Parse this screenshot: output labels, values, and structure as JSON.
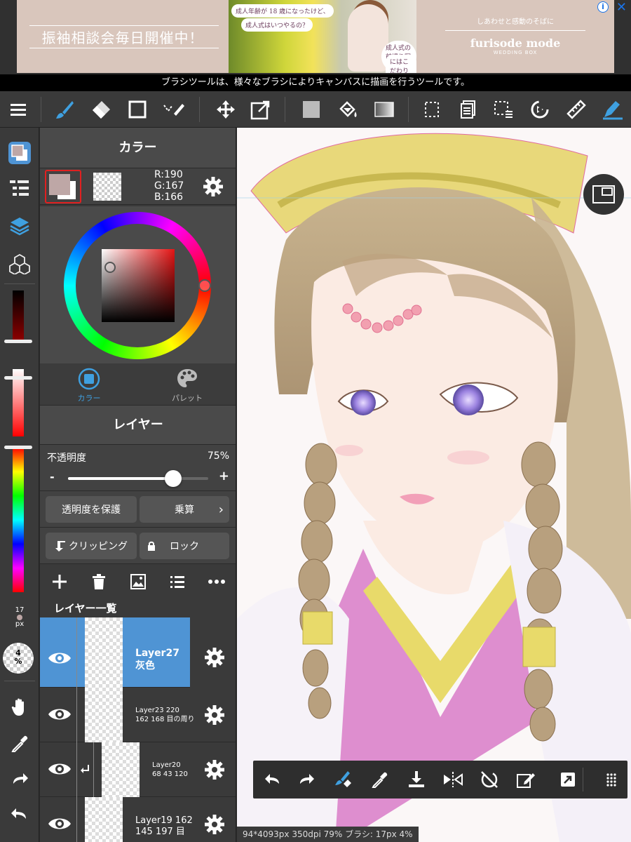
{
  "ad": {
    "left_text": "振袖相談会毎日開催中！",
    "bubble1": "成人年齢が 18 歳になったけど、",
    "bubble2": "成人式はいつやるの？",
    "bubble3": "成人式の前撮り写真",
    "bubble4": "にはこだわりたい！",
    "right_sub": "しあわせと感動のそばに",
    "brand": "furisode mode",
    "brand_sub": "WEDDING BOX",
    "info_icon": "i",
    "close_icon": "✕"
  },
  "hint": "ブラシツールは、様々なブラシによりキャンバスに描画を行うツールです。",
  "colors": {
    "accent": "#4f94d4",
    "panel": "#3a3a3a",
    "current_color": "#bea7a6"
  },
  "color_panel": {
    "title": "カラー",
    "r": "R:190",
    "g": "G:167",
    "b": "B:166",
    "tab_color": "カラー",
    "tab_palette": "パレット"
  },
  "layer_panel": {
    "title": "レイヤー",
    "opacity_label": "不透明度",
    "opacity_value": "75%",
    "opacity_fraction": 0.75,
    "minus": "-",
    "plus": "+",
    "protect_alpha": "透明度を保護",
    "blend_mode": "乗算",
    "clipping": "クリッピング",
    "lock": "ロック",
    "list_title": "レイヤー一覧"
  },
  "layers": [
    {
      "name1": "Layer27",
      "name2": "灰色",
      "selected": true
    },
    {
      "name1": "Layer23 220",
      "name2": "162 168 目の周り",
      "selected": false
    },
    {
      "name1": "Layer20",
      "name2": "68 43 120",
      "selected": false
    },
    {
      "name1": "Layer19 162",
      "name2": "145 197 目",
      "selected": false
    }
  ],
  "rail": {
    "brush_size": "17",
    "brush_unit": "px",
    "opacity_percent": "4",
    "opacity_unit": "%"
  },
  "status": "94*4093px 350dpi 79% ブラシ: 17px 4%",
  "icons": {
    "toolbar": [
      "menu-icon",
      "brush-icon",
      "eraser-icon",
      "rectangle-icon",
      "select-pen-icon",
      "move-icon",
      "transform-icon",
      "fill-color-icon",
      "bucket-icon",
      "gradient-icon",
      "select-rect-icon",
      "layer-list-icon",
      "selection-menu-icon",
      "snap-icon",
      "ruler-icon",
      "pen-tool-icon"
    ],
    "floatbar": [
      "undo-icon",
      "redo-icon",
      "brush-eraser-toggle-icon",
      "eyedropper-icon",
      "save-icon",
      "flip-icon",
      "rotate-reset-icon",
      "clear-icon",
      "share-icon",
      "grid-icon"
    ]
  }
}
